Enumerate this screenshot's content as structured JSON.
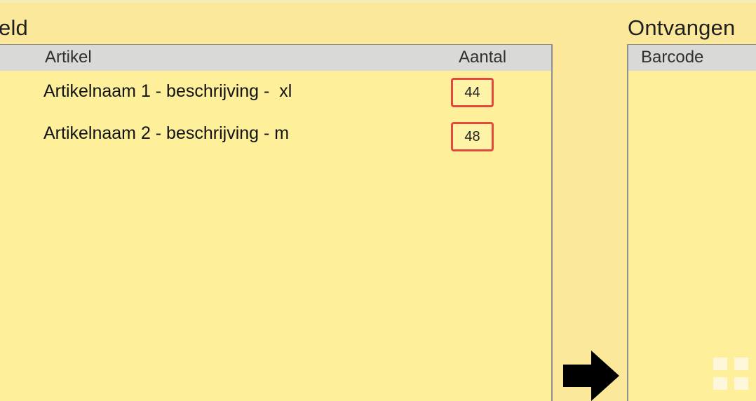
{
  "left_section": {
    "title": "eld",
    "columns": {
      "artikel": "Artikel",
      "aantal": "Aantal"
    },
    "items": [
      {
        "name": "Artikelnaam 1 - beschrijving -  xl",
        "quantity": "44"
      },
      {
        "name": "Artikelnaam 2 - beschrijving - m",
        "quantity": "48"
      }
    ]
  },
  "right_section": {
    "title": "Ontvangen",
    "columns": {
      "barcode": "Barcode"
    }
  },
  "icons": {
    "move": "arrow-right-icon",
    "menu": "grid-icon"
  },
  "colors": {
    "background": "#fbe89a",
    "panel": "#fef09a",
    "header": "#d9d9d7",
    "quantity_border": "#e34a3e"
  }
}
